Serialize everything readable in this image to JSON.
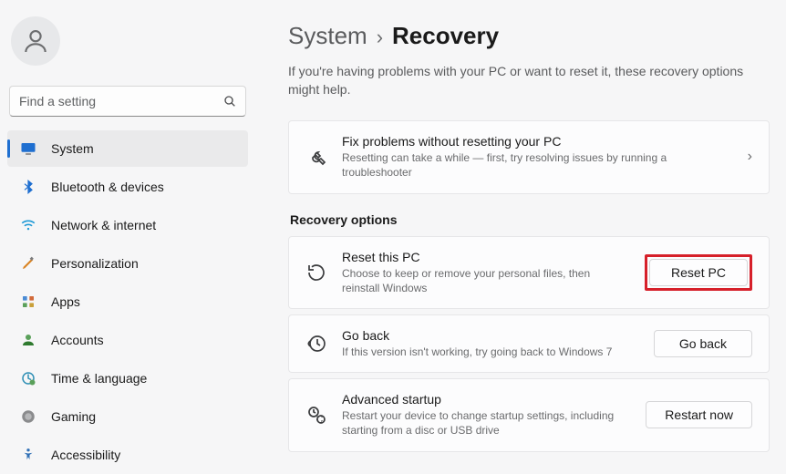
{
  "search": {
    "placeholder": "Find a setting"
  },
  "sidebar": {
    "items": [
      {
        "label": "System"
      },
      {
        "label": "Bluetooth & devices"
      },
      {
        "label": "Network & internet"
      },
      {
        "label": "Personalization"
      },
      {
        "label": "Apps"
      },
      {
        "label": "Accounts"
      },
      {
        "label": "Time & language"
      },
      {
        "label": "Gaming"
      },
      {
        "label": "Accessibility"
      }
    ]
  },
  "breadcrumb": {
    "parent": "System",
    "sep": "›",
    "current": "Recovery"
  },
  "description": "If you're having problems with your PC or want to reset it, these recovery options might help.",
  "fixcard": {
    "title": "Fix problems without resetting your PC",
    "sub": "Resetting can take a while — first, try resolving issues by running a troubleshooter"
  },
  "sectionTitle": "Recovery options",
  "reset": {
    "title": "Reset this PC",
    "sub": "Choose to keep or remove your personal files, then reinstall Windows",
    "button": "Reset PC"
  },
  "goback": {
    "title": "Go back",
    "sub": "If this version isn't working, try going back to Windows 7",
    "button": "Go back"
  },
  "advanced": {
    "title": "Advanced startup",
    "sub": "Restart your device to change startup settings, including starting from a disc or USB drive",
    "button": "Restart now"
  }
}
